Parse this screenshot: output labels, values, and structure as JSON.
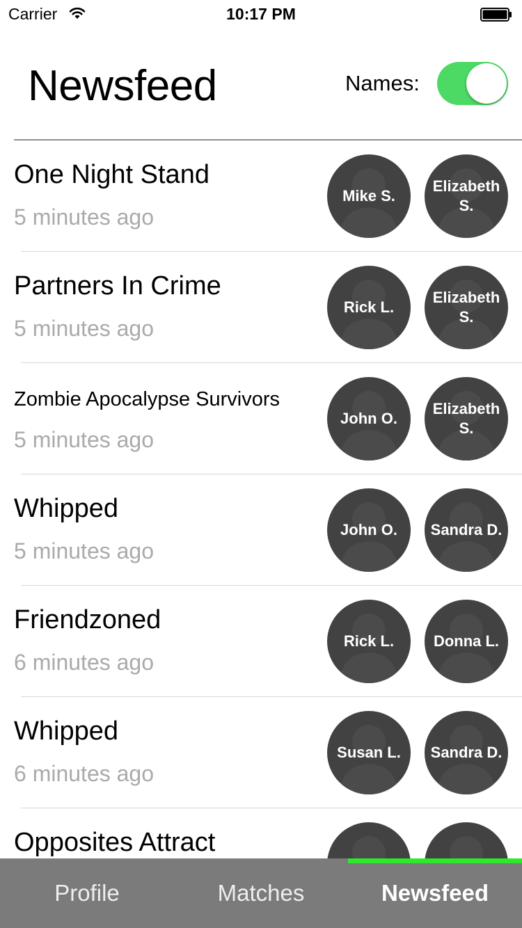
{
  "status_bar": {
    "carrier": "Carrier",
    "time": "10:17 PM"
  },
  "header": {
    "title": "Newsfeed",
    "names_label": "Names:",
    "names_toggle_on": true
  },
  "feed": [
    {
      "title": "One Night Stand",
      "time": "5 minutes ago",
      "people": [
        "Mike S.",
        "Elizabeth S."
      ]
    },
    {
      "title": "Partners In Crime",
      "time": "5 minutes ago",
      "people": [
        "Rick L.",
        "Elizabeth S."
      ]
    },
    {
      "title": "Zombie Apocalypse Survivors",
      "time": "5 minutes ago",
      "people": [
        "John O.",
        "Elizabeth S."
      ]
    },
    {
      "title": "Whipped",
      "time": "5 minutes ago",
      "people": [
        "John O.",
        "Sandra D."
      ]
    },
    {
      "title": "Friendzoned",
      "time": "6 minutes ago",
      "people": [
        "Rick L.",
        "Donna L."
      ]
    },
    {
      "title": "Whipped",
      "time": "6 minutes ago",
      "people": [
        "Susan L.",
        "Sandra D."
      ]
    },
    {
      "title": "Opposites Attract",
      "time": "",
      "people": [
        "",
        ""
      ]
    }
  ],
  "tabs": [
    {
      "label": "Profile",
      "active": false
    },
    {
      "label": "Matches",
      "active": false
    },
    {
      "label": "Newsfeed",
      "active": true
    }
  ],
  "colors": {
    "toggle_on": "#4cd964",
    "tab_indicator": "#2ee82e",
    "avatar_bg": "#424242",
    "tab_bar_bg": "#7b7b7b"
  },
  "icons": {
    "wifi": "wifi-icon",
    "battery": "battery-icon",
    "avatar_placeholder": "person-silhouette-icon"
  }
}
